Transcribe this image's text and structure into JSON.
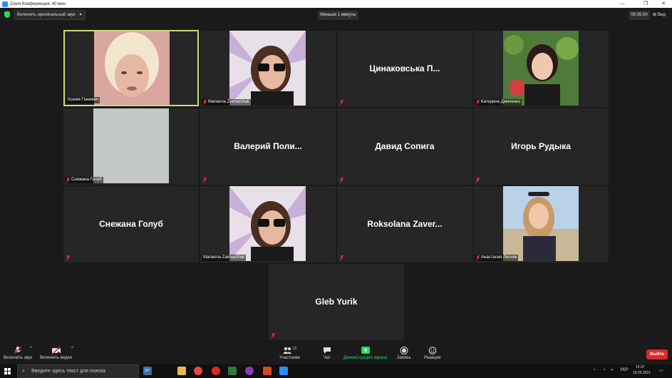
{
  "window": {
    "title": "Zoom Конференция, 40 мин"
  },
  "topbar": {
    "original_sound_label": "Включить оригинальный звук",
    "meeting_timer": "Меньше 1 минуты",
    "clock": "00:35:00",
    "view_label": "Вид"
  },
  "tiles": {
    "t1": {
      "label": "Ксенія Гінкевич"
    },
    "t2": {
      "label": "Marianna Zakharchuk"
    },
    "t3": {
      "center_name": "Цинаковська П..."
    },
    "t4": {
      "label": "Катерина Демченко"
    },
    "t5": {
      "label": "Снежана Голуб"
    },
    "t6": {
      "center_name": "Валерий Поли..."
    },
    "t7": {
      "center_name": "Давид Сопига"
    },
    "t8": {
      "center_name": "Игорь Рудыка"
    },
    "t9": {
      "center_name": "Снежана Голуб"
    },
    "t10": {
      "label": "Marianna Zakharchuk"
    },
    "t11": {
      "center_name": "Roksolana Zaver..."
    },
    "t12": {
      "label": "Анастасия Лесняк"
    },
    "t13": {
      "center_name": "Gleb Yurik"
    }
  },
  "toolbar": {
    "unmute": "Включить звук",
    "start_video": "Включить видео",
    "participants": "Участники",
    "participants_count": "13",
    "chat": "Чат",
    "share": "Демонстрация экрана",
    "record": "Запись",
    "reactions": "Реакции",
    "leave": "Выйти"
  },
  "taskbar": {
    "search_placeholder": "Введите здесь текст для поиска",
    "weather": "20°",
    "lang": "УКР",
    "time": "15:37",
    "date": "18.05.2021"
  },
  "colors": {
    "active_speaker_border": "#c8dc78",
    "share_green": "#23d959",
    "leave_red": "#e02828",
    "tile_bg": "#262626"
  }
}
